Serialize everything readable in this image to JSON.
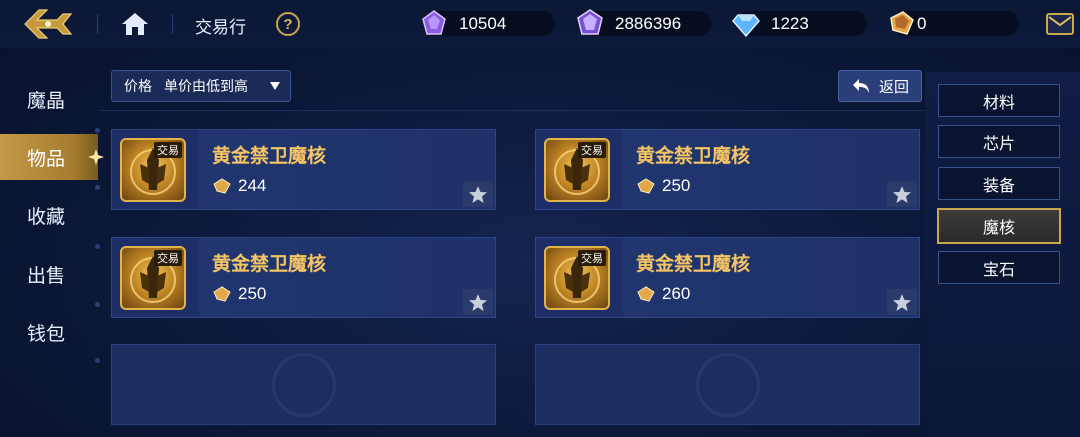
{
  "header": {
    "title": "交易行",
    "help": "?",
    "currencies": [
      {
        "icon": "purple-crystal-icon",
        "value": "10504"
      },
      {
        "icon": "purple-gem-icon",
        "value": "2886396"
      },
      {
        "icon": "blue-diamond-icon",
        "value": "1223"
      },
      {
        "icon": "gold-diamond-icon",
        "value": "0"
      }
    ]
  },
  "nav": {
    "items": [
      {
        "label": "魔晶"
      },
      {
        "label": "物品"
      },
      {
        "label": "收藏"
      },
      {
        "label": "出售"
      },
      {
        "label": "钱包"
      }
    ],
    "active": "物品"
  },
  "sort": {
    "label": "价格",
    "value": "单价由低到高"
  },
  "back_button": "返回",
  "items": [
    {
      "name": "黄金禁卫魔核",
      "price": "244",
      "tag": "交易"
    },
    {
      "name": "黄金禁卫魔核",
      "price": "250",
      "tag": "交易"
    },
    {
      "name": "黄金禁卫魔核",
      "price": "250",
      "tag": "交易"
    },
    {
      "name": "黄金禁卫魔核",
      "price": "260",
      "tag": "交易"
    }
  ],
  "categories": [
    {
      "label": "材料"
    },
    {
      "label": "芯片"
    },
    {
      "label": "装备"
    },
    {
      "label": "魔核"
    },
    {
      "label": "宝石"
    }
  ],
  "active_category": "魔核",
  "colors": {
    "gold": "#c9a650",
    "item_name": "#f6c563",
    "background": "#0c1838",
    "card": "#1d2f66"
  }
}
